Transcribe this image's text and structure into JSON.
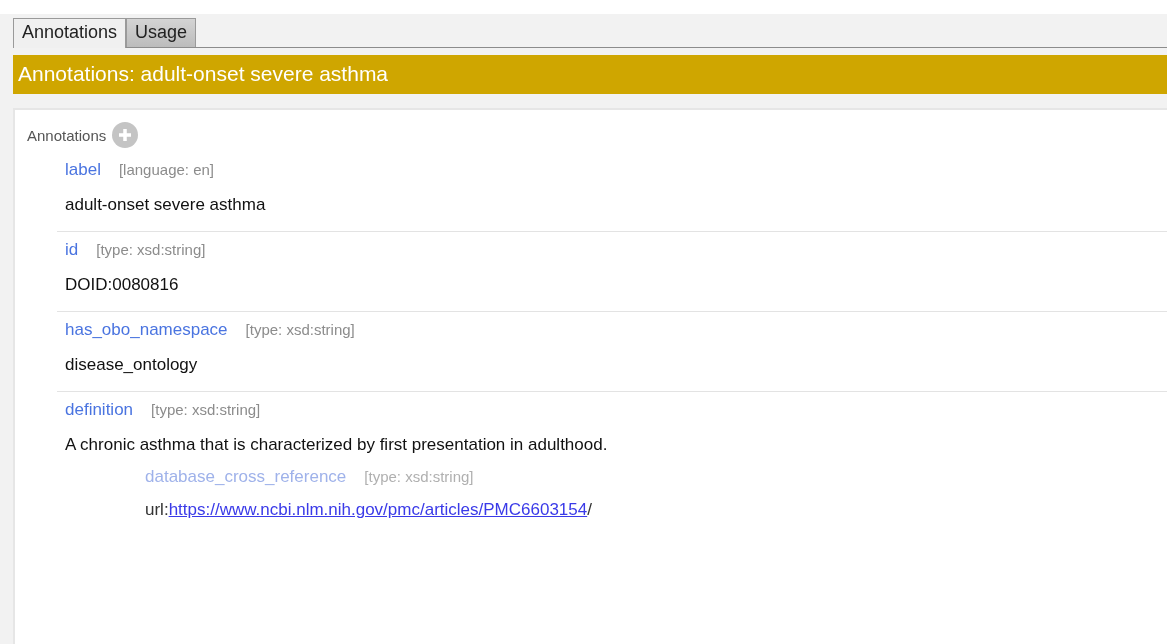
{
  "tabs": [
    {
      "label": "Annotations",
      "selected": true
    },
    {
      "label": "Usage",
      "selected": false
    }
  ],
  "header": {
    "title": "Annotations: adult-onset severe asthma"
  },
  "section": {
    "title": "Annotations",
    "annotations": [
      {
        "property": "label",
        "datatype": "[language: en]",
        "value": {
          "text": "adult-onset severe asthma"
        }
      },
      {
        "property": "id",
        "datatype": "[type: xsd:string]",
        "value": {
          "text": "DOID:0080816"
        }
      },
      {
        "property": "has_obo_namespace",
        "datatype": "[type: xsd:string]",
        "value": {
          "text": "disease_ontology"
        }
      },
      {
        "property": "definition",
        "datatype": "[type: xsd:string]",
        "value": {
          "text": "A chronic asthma that is characterized by first presentation in adulthood."
        },
        "annotations": [
          {
            "property": "database_cross_reference",
            "datatype": "[type: xsd:string]",
            "value": {
              "prefix": "url:",
              "link": "https://www.ncbi.nlm.nih.gov/pmc/articles/PMC6603154",
              "suffix": "/"
            }
          }
        ]
      }
    ]
  }
}
